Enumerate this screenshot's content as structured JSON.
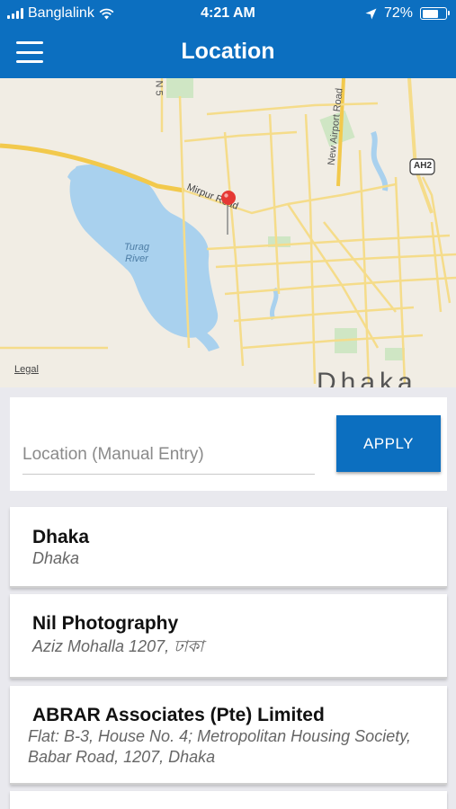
{
  "status_bar": {
    "carrier": "Banglalink",
    "time": "4:21 AM",
    "battery_percent": "72%",
    "battery_level": 0.72,
    "icons": [
      "signal-bars-icon",
      "wifi-icon",
      "location-arrow-icon",
      "battery-icon"
    ]
  },
  "header": {
    "title": "Location",
    "menu_icon": "hamburger-menu-icon",
    "color": "#0c6fc0"
  },
  "map": {
    "labels": {
      "mirpur_road": "Mirpur Road",
      "new_airport_road": "New Airport Road",
      "ah2": "AH2",
      "turag_river": "Turag River",
      "n5": "N 5",
      "dhaka": "Dhaka",
      "legal": "Legal"
    },
    "pin_icon": "map-pin-icon"
  },
  "search": {
    "placeholder": "Location (Manual Entry)",
    "value": "",
    "apply_label": "APPLY"
  },
  "results": [
    {
      "name": "Dhaka",
      "address": "Dhaka"
    },
    {
      "name": "Nil Photography",
      "address": "Aziz Mohalla 1207, ঢাকা"
    },
    {
      "name": "ABRAR Associates (Pte) Limited",
      "address": "Flat: B-3, House No. 4; Metropolitan Housing Society, Babar Road, 1207, Dhaka"
    },
    {
      "name": "",
      "address": ""
    }
  ]
}
